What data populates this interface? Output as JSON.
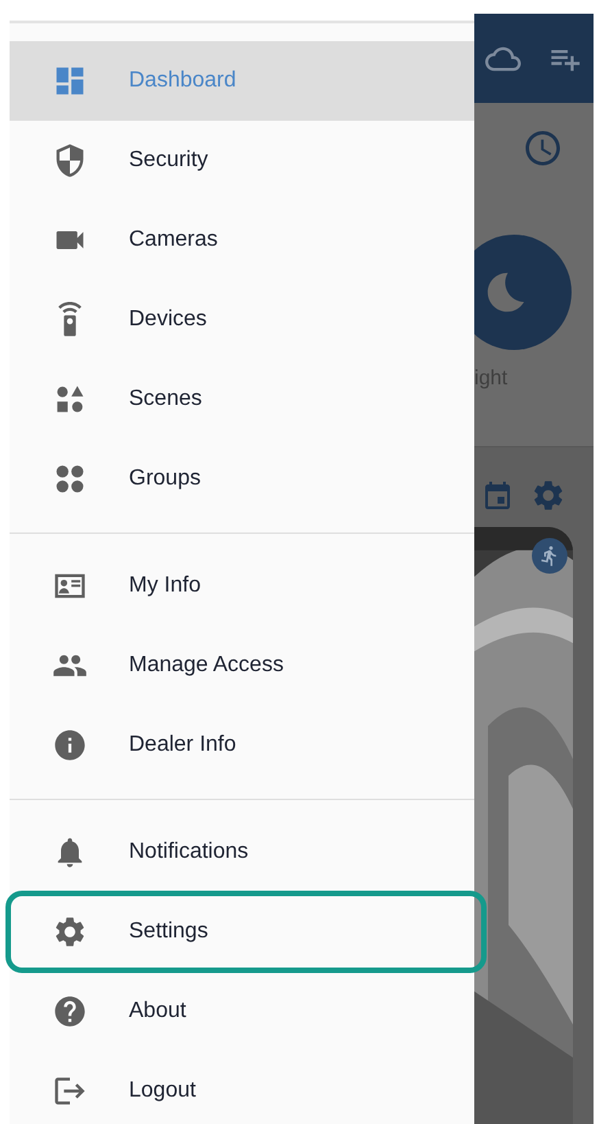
{
  "drawer": {
    "sections": [
      {
        "items": [
          {
            "label": "Dashboard",
            "selected": true,
            "highlighted": false
          },
          {
            "label": "Security",
            "selected": false,
            "highlighted": false
          },
          {
            "label": "Cameras",
            "selected": false,
            "highlighted": false
          },
          {
            "label": "Devices",
            "selected": false,
            "highlighted": false
          },
          {
            "label": "Scenes",
            "selected": false,
            "highlighted": false
          },
          {
            "label": "Groups",
            "selected": false,
            "highlighted": false
          }
        ]
      },
      {
        "items": [
          {
            "label": "My Info",
            "selected": false,
            "highlighted": false
          },
          {
            "label": "Manage Access",
            "selected": false,
            "highlighted": false
          },
          {
            "label": "Dealer Info",
            "selected": false,
            "highlighted": false
          }
        ]
      },
      {
        "items": [
          {
            "label": "Notifications",
            "selected": false,
            "highlighted": false
          },
          {
            "label": "Settings",
            "selected": false,
            "highlighted": true
          },
          {
            "label": "About",
            "selected": false,
            "highlighted": false
          },
          {
            "label": "Logout",
            "selected": false,
            "highlighted": false
          }
        ]
      }
    ]
  },
  "background_app": {
    "scene_label": "ight"
  }
}
